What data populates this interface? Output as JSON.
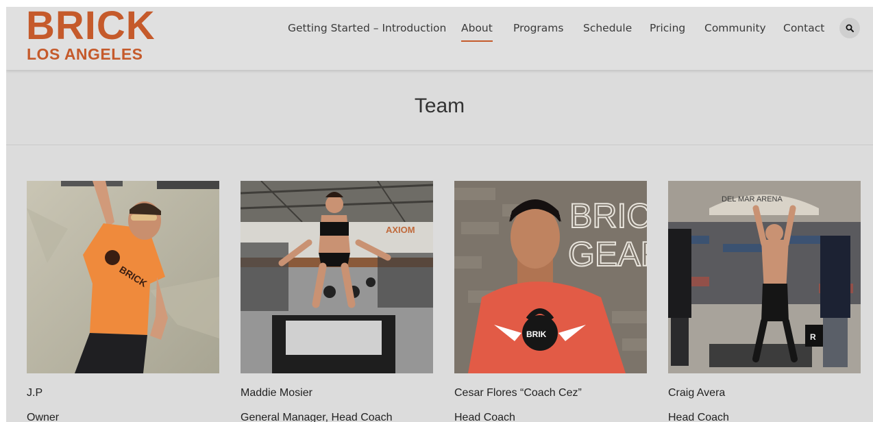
{
  "brand": {
    "logo_top": "BRICK",
    "logo_bottom": "LOS ANGELES",
    "accent_color": "#c55a2b"
  },
  "nav": {
    "items": [
      {
        "label": "Getting Started – Introduction",
        "active": false
      },
      {
        "label": "About",
        "active": true
      },
      {
        "label": "Programs",
        "active": false
      },
      {
        "label": "Schedule",
        "active": false
      },
      {
        "label": "Pricing",
        "active": false
      },
      {
        "label": "Community",
        "active": false
      },
      {
        "label": "Contact",
        "active": false
      }
    ],
    "search_icon": "search-icon"
  },
  "page": {
    "title": "Team"
  },
  "team": [
    {
      "name": "J.P",
      "role": "Owner"
    },
    {
      "name": "Maddie Mosier",
      "role": "General Manager, Head Coach"
    },
    {
      "name": "Cesar Flores “Coach Cez”",
      "role": "Head Coach"
    },
    {
      "name": "Craig Avera",
      "role": "Head Coach"
    }
  ],
  "photo_text": {
    "jp_shirt": "BRICK",
    "maddie_wall": "AXIOM",
    "cesar_wall_1": "BRICK",
    "cesar_wall_2": "GEAR",
    "cesar_shirt": "BRIK",
    "craig_arena": "DEL MAR ARENA",
    "craig_plate": "R"
  }
}
